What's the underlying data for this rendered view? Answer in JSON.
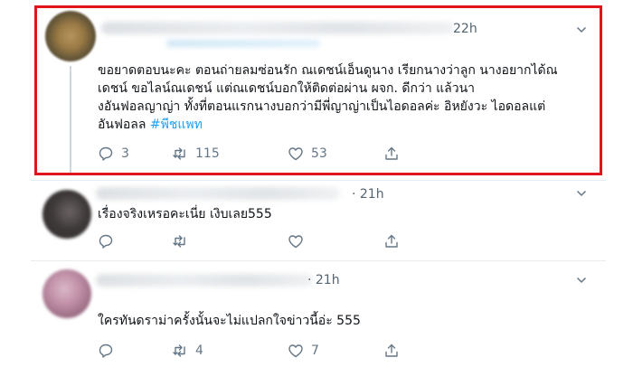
{
  "colors": {
    "highlight_border": "#e0151b",
    "hashtag": "#1da1f2",
    "meta_text": "#536471",
    "action_icon": "#657786"
  },
  "tweets": [
    {
      "time": "22h",
      "text_lines": [
        "ขอยาดตอบนะคะ ตอนถ่ายลมซ่อนรัก ณเดชน์เอ็นดูนาง เรียกนางว่าลูก นางอยากได้ณ",
        "เดชน์ ขอไลน์ณเดชน์ แต่ณเดชน์บอกให้ติดต่อผ่าน ผจก. ดีกว่า แล้วนา",
        "งอันฟอลญาญ่า ทั้งที่ตอนแรกนางบอกว่ามีพี่ญาญ่าเป็นไอดอลค่ะ อิหยังวะ ไอดอลแต่",
        "อันฟอลล"
      ],
      "hashtag": "#พีชแพท",
      "reply_count": "3",
      "retweet_count": "115",
      "like_count": "53"
    },
    {
      "time": "· 21h",
      "text_lines": [
        "เรื่องจริงเหรอคะเนี่ย เงิบเลย555"
      ],
      "reply_count": "",
      "retweet_count": "",
      "like_count": ""
    },
    {
      "time": "· 21h",
      "text_lines": [
        "ใครทันดราม่าครั้งนั้นจะไม่แปลกใจข่าวนี้อ่ะ 555"
      ],
      "reply_count": "",
      "retweet_count": "4",
      "like_count": "7"
    }
  ],
  "icons": {
    "reply": "reply-icon",
    "retweet": "retweet-icon",
    "like": "heart-icon",
    "share": "share-icon",
    "more": "chevron-down-icon"
  }
}
